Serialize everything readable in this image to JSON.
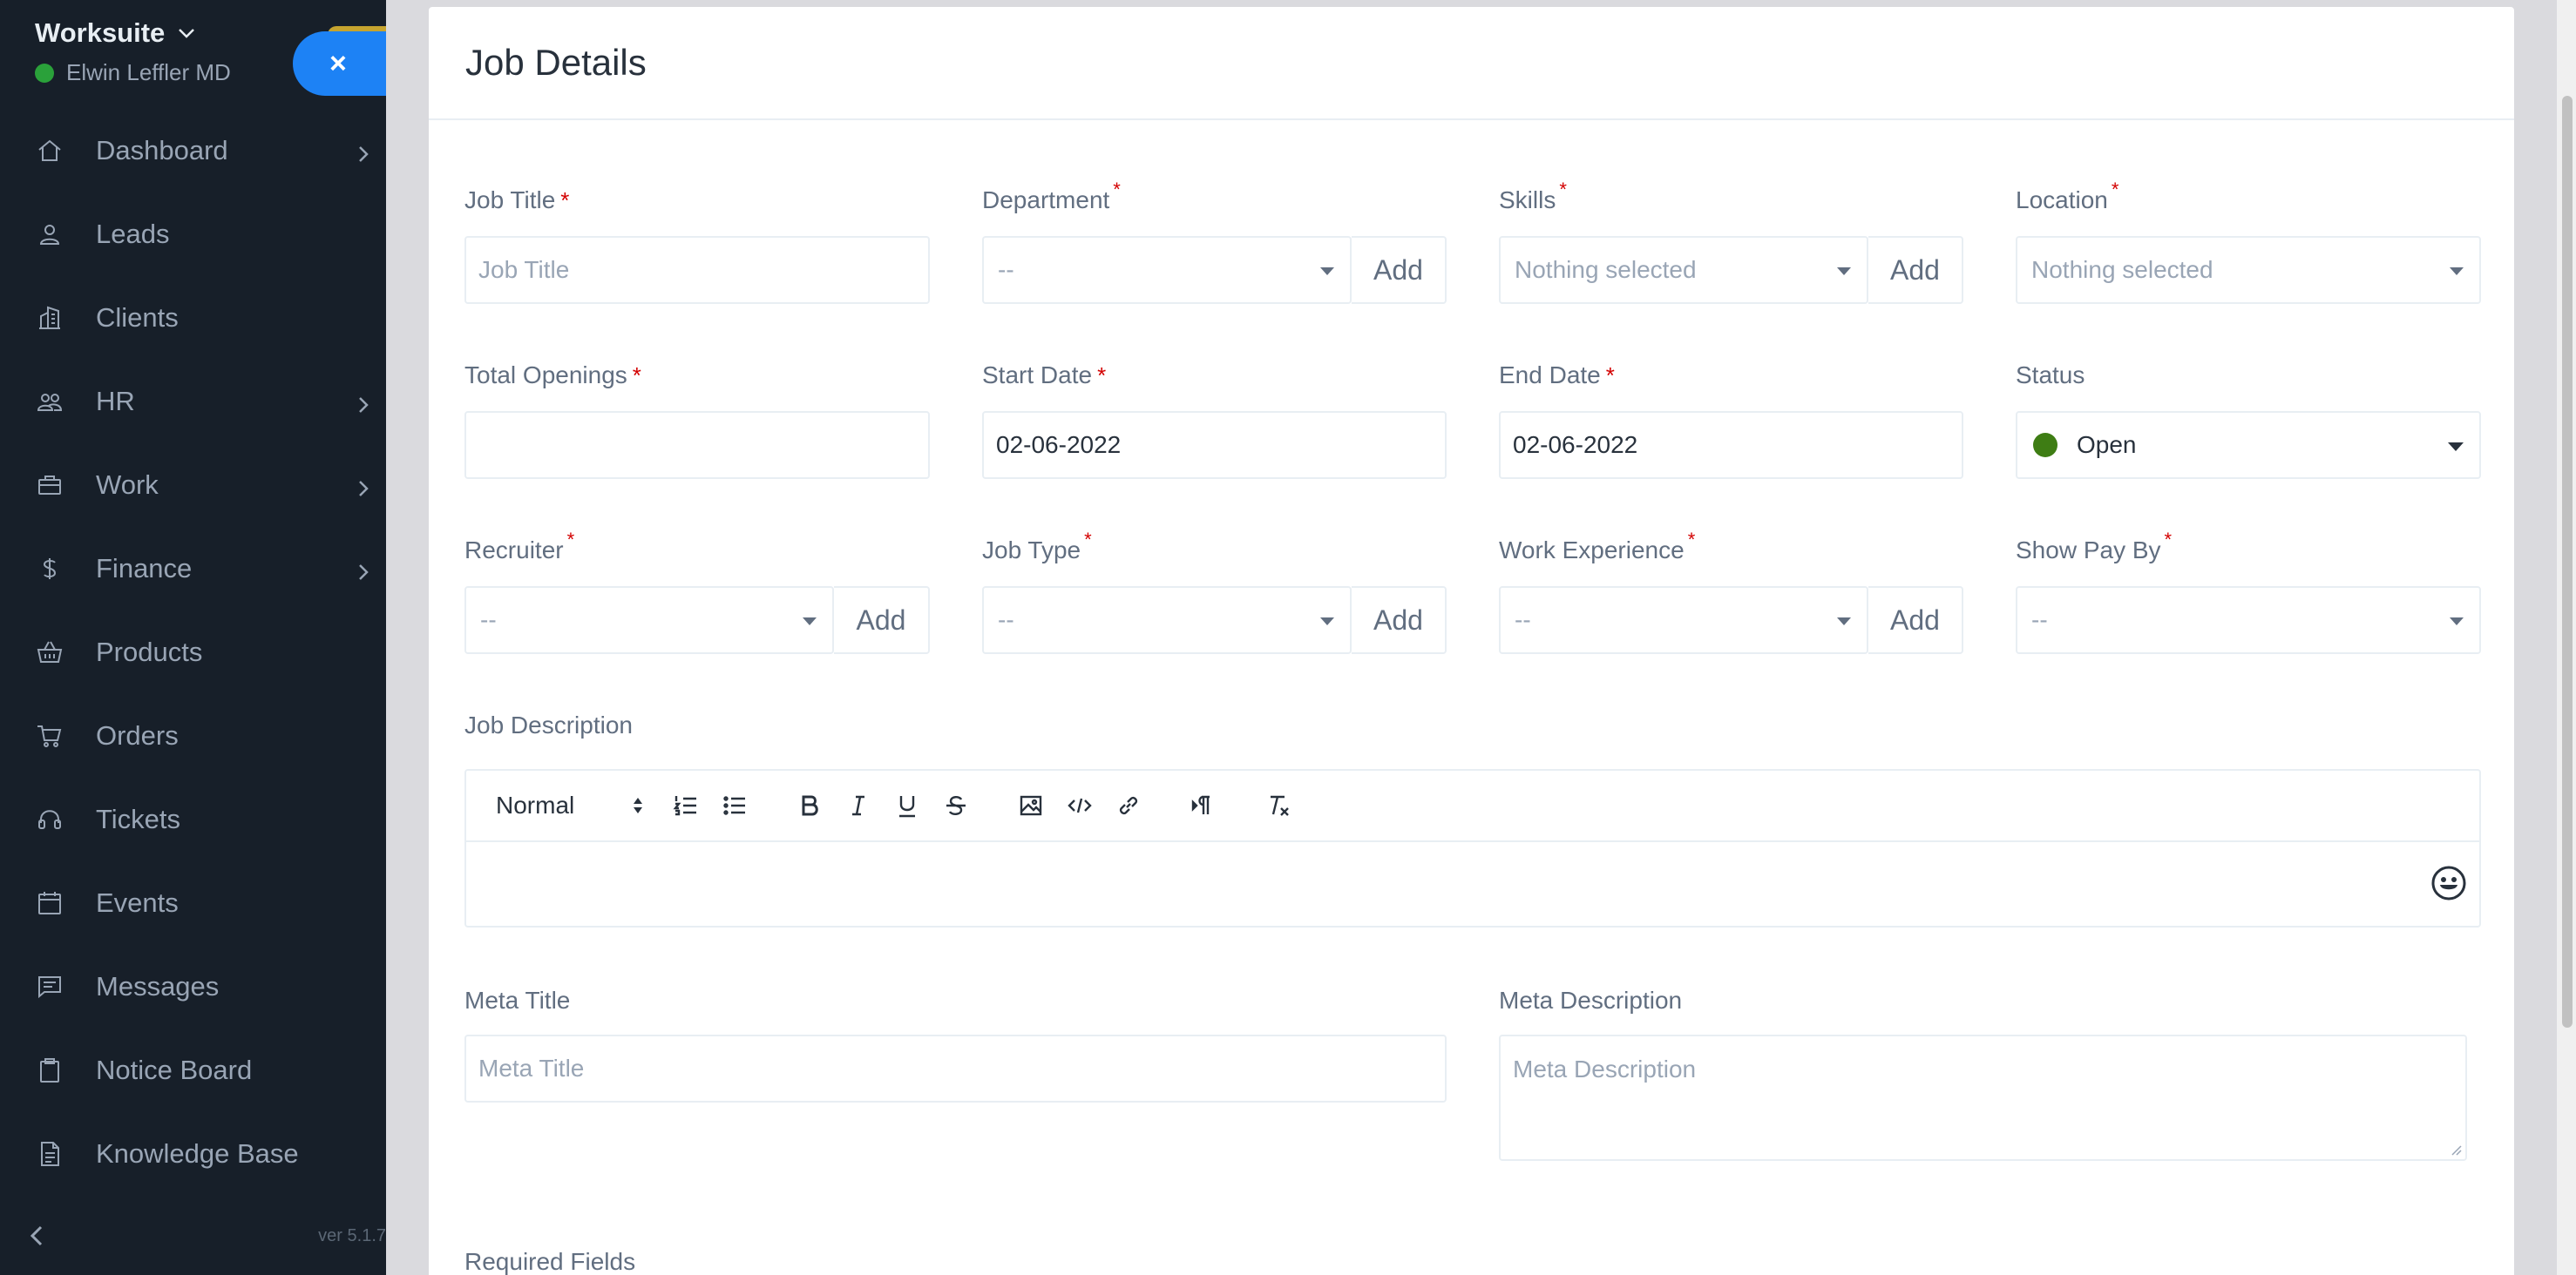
{
  "sidebar": {
    "brand": "Worksuite",
    "user": "Elwin Leffler MD",
    "close_label": "×",
    "version": "ver 5.1.7",
    "items": [
      {
        "label": "Dashboard",
        "icon": "home-icon",
        "has_children": true
      },
      {
        "label": "Leads",
        "icon": "user-icon",
        "has_children": false
      },
      {
        "label": "Clients",
        "icon": "building-icon",
        "has_children": false
      },
      {
        "label": "HR",
        "icon": "people-icon",
        "has_children": true
      },
      {
        "label": "Work",
        "icon": "briefcase-icon",
        "has_children": true
      },
      {
        "label": "Finance",
        "icon": "dollar-icon",
        "has_children": true
      },
      {
        "label": "Products",
        "icon": "basket-icon",
        "has_children": false
      },
      {
        "label": "Orders",
        "icon": "cart-icon",
        "has_children": false
      },
      {
        "label": "Tickets",
        "icon": "headset-icon",
        "has_children": false
      },
      {
        "label": "Events",
        "icon": "calendar-icon",
        "has_children": false
      },
      {
        "label": "Messages",
        "icon": "message-icon",
        "has_children": false
      },
      {
        "label": "Notice Board",
        "icon": "clipboard-icon",
        "has_children": false
      },
      {
        "label": "Knowledge Base",
        "icon": "document-icon",
        "has_children": false
      }
    ]
  },
  "form": {
    "title": "Job Details",
    "job_title": {
      "label": "Job Title",
      "placeholder": "Job Title"
    },
    "department": {
      "label": "Department",
      "value": "--",
      "add": "Add"
    },
    "skills": {
      "label": "Skills",
      "value": "Nothing selected",
      "add": "Add"
    },
    "location": {
      "label": "Location",
      "value": "Nothing selected"
    },
    "total_openings": {
      "label": "Total Openings",
      "value": ""
    },
    "start_date": {
      "label": "Start Date",
      "value": "02-06-2022"
    },
    "end_date": {
      "label": "End Date",
      "value": "02-06-2022"
    },
    "status": {
      "label": "Status",
      "value": "Open",
      "color": "#3e7d14"
    },
    "recruiter": {
      "label": "Recruiter",
      "value": "--",
      "add": "Add"
    },
    "job_type": {
      "label": "Job Type",
      "value": "--",
      "add": "Add"
    },
    "work_experience": {
      "label": "Work Experience",
      "value": "--",
      "add": "Add"
    },
    "show_pay_by": {
      "label": "Show Pay By",
      "value": "--"
    },
    "job_description": {
      "label": "Job Description",
      "format": "Normal"
    },
    "meta_title": {
      "label": "Meta Title",
      "placeholder": "Meta Title"
    },
    "meta_description": {
      "label": "Meta Description",
      "placeholder": "Meta Description"
    },
    "required_fields": "Required Fields",
    "required_mark": "*"
  }
}
